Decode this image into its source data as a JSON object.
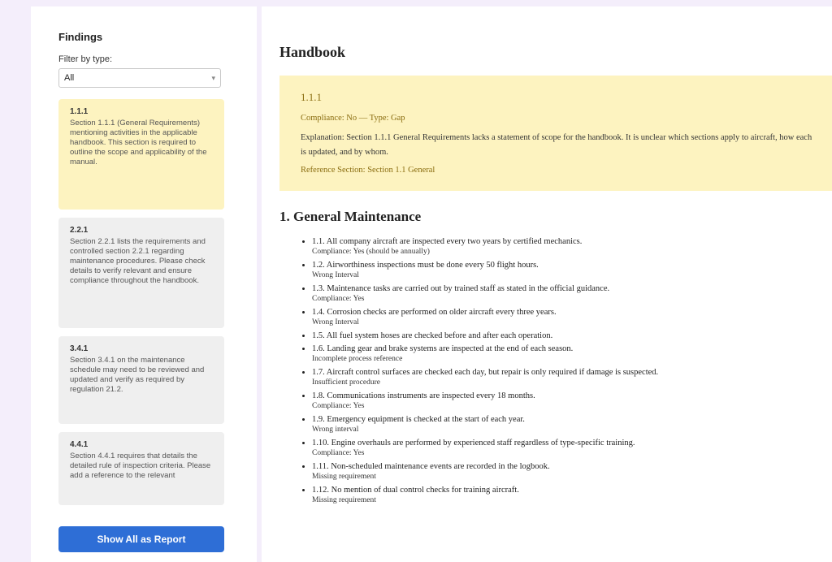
{
  "sidebar": {
    "title": "Findings",
    "filter_label": "Filter by type:",
    "filter_value": "All",
    "cards": [
      {
        "id": "1.1.1",
        "text": "Section 1.1.1 (General Requirements) mentioning activities in the applicable handbook. This section is required to outline the scope and applicability of the manual."
      },
      {
        "id": "2.2.1",
        "text": "Section 2.2.1 lists the requirements and controlled section 2.2.1 regarding maintenance procedures. Please check details to verify relevant and ensure compliance throughout the handbook."
      },
      {
        "id": "3.4.1",
        "text": "Section 3.4.1 on the maintenance schedule may need to be reviewed and updated and verify as required by regulation 21.2."
      },
      {
        "id": "4.4.1",
        "text": "Section 4.4.1 requires that details the detailed rule of inspection criteria. Please add a reference to the relevant"
      }
    ],
    "report_button": "Show All as Report"
  },
  "main": {
    "title": "Handbook",
    "callout": {
      "id": "1.1.1",
      "compliance": "Compliance: No — Type: Gap",
      "explanation": "Explanation: Section 1.1.1 General Requirements lacks a statement of scope for the handbook. It is unclear which sections apply to aircraft, how each is updated, and by whom.",
      "reference": "Reference Section: Section 1.1 General"
    },
    "section_title": "1. General Maintenance",
    "items": [
      {
        "text": "1.1. All company aircraft are inspected every two years by certified mechanics.",
        "status": "Compliance: Yes (should be annually)"
      },
      {
        "text": "1.2. Airworthiness inspections must be done every 50 flight hours.",
        "status": "Wrong Interval"
      },
      {
        "text": "1.3. Maintenance tasks are carried out by trained staff as stated in the official guidance.",
        "status": "Compliance: Yes"
      },
      {
        "text": "1.4. Corrosion checks are performed on older aircraft every three years.",
        "status": "Wrong Interval"
      },
      {
        "text": "1.5. All fuel system hoses are checked before and after each operation.",
        "status": ""
      },
      {
        "text": "1.6. Landing gear and brake systems are inspected at the end of each season.",
        "status": "Incomplete process reference"
      },
      {
        "text": "1.7. Aircraft control surfaces are checked each day, but repair is only required if damage is suspected.",
        "status": "Insufficient procedure"
      },
      {
        "text": "1.8. Communications instruments are inspected every 18 months.",
        "status": "Compliance: Yes"
      },
      {
        "text": "1.9. Emergency equipment is checked at the start of each year.",
        "status": "Wrong interval"
      },
      {
        "text": "1.10. Engine overhauls are performed by experienced staff regardless of type-specific training.",
        "status": "Compliance: Yes"
      },
      {
        "text": "1.11. Non-scheduled maintenance events are recorded in the logbook.",
        "status": "Missing requirement"
      },
      {
        "text": "1.12. No mention of dual control checks for training aircraft.",
        "status": "Missing requirement"
      }
    ]
  }
}
